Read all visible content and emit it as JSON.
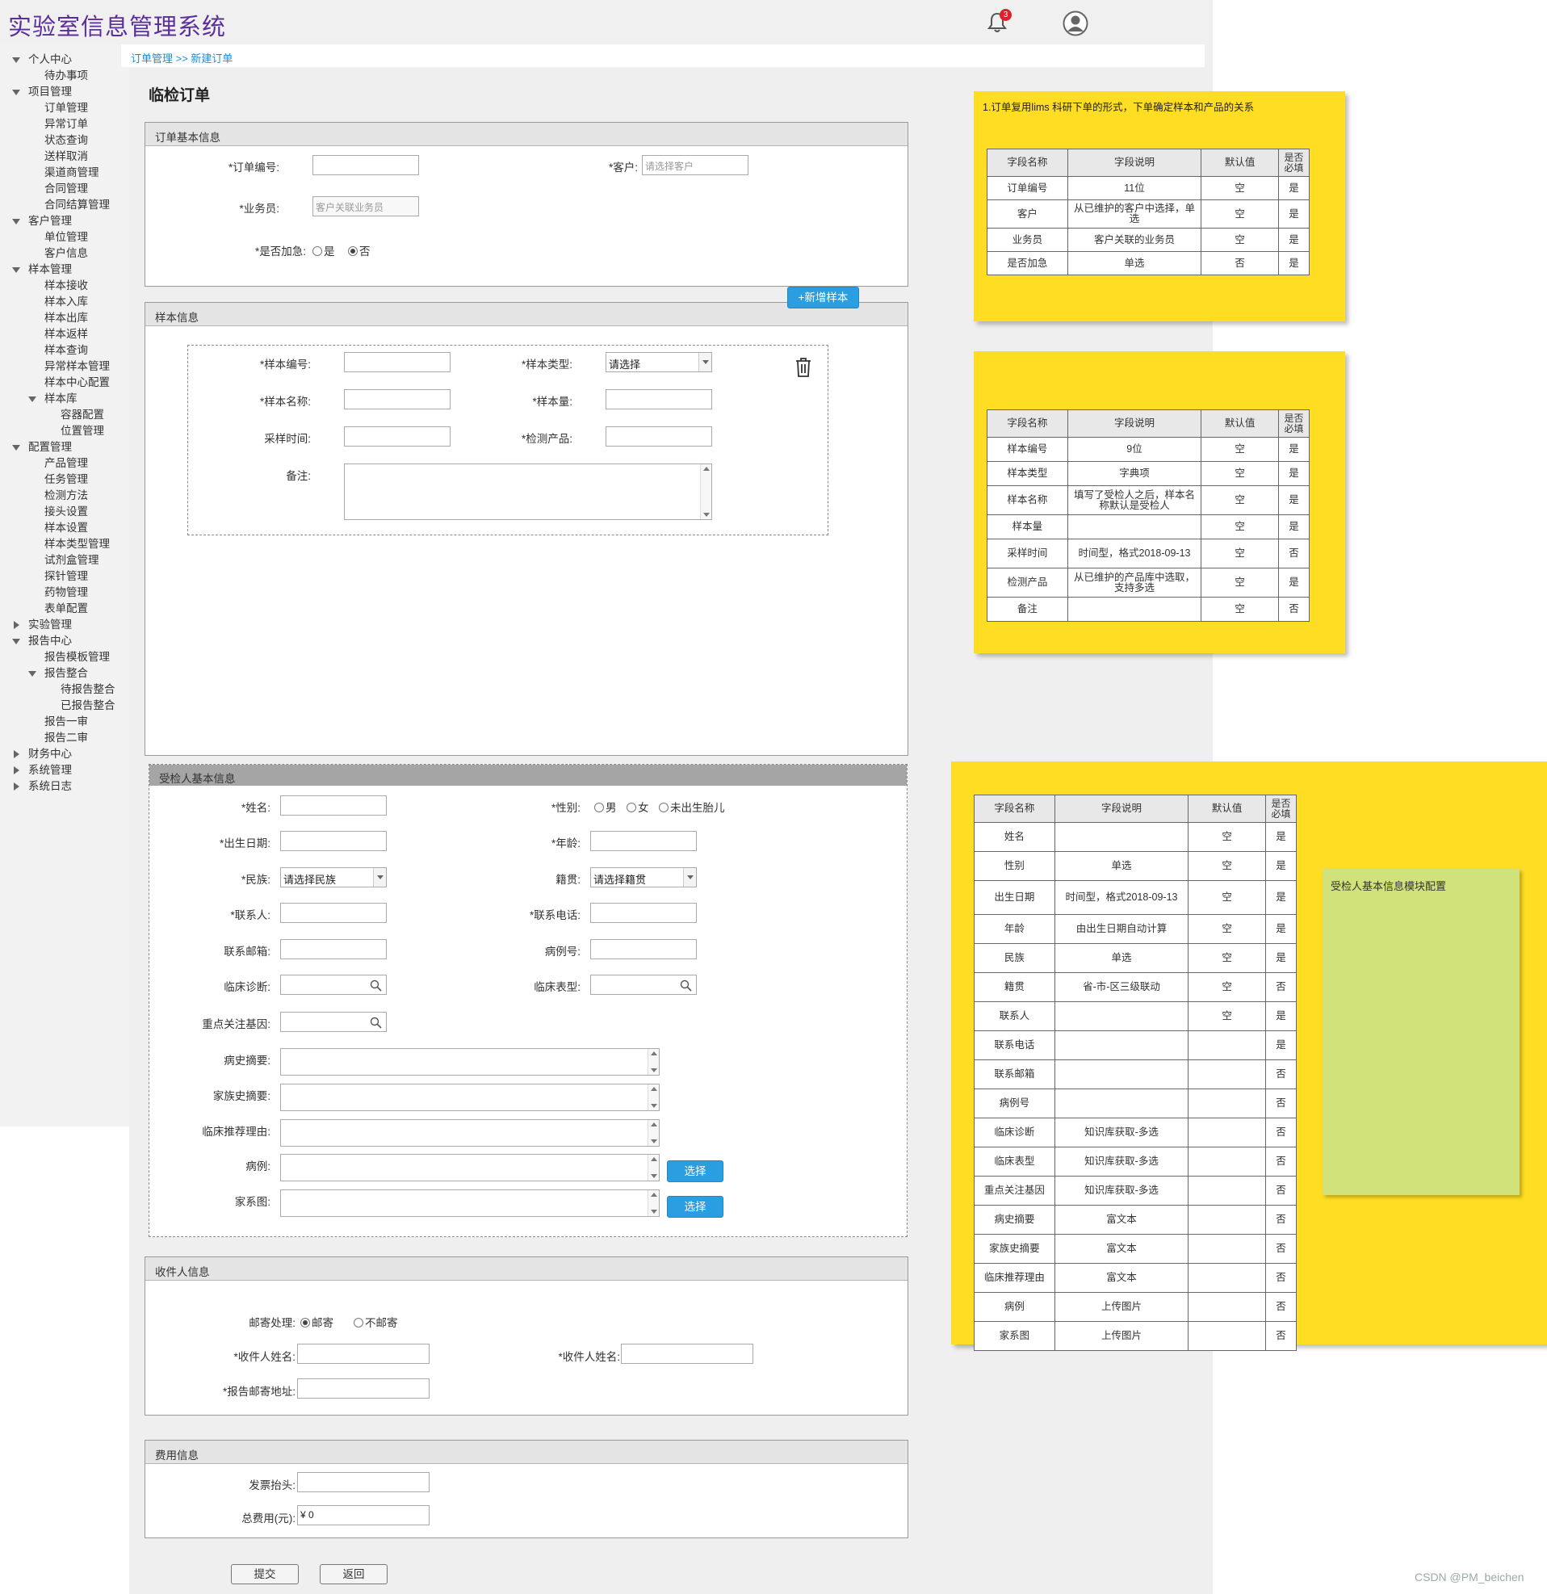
{
  "app": {
    "title": "实验室信息管理系统",
    "notification_count": "3"
  },
  "sidebar": {
    "items": [
      {
        "label": "个人中心",
        "level": 0,
        "state": "expanded"
      },
      {
        "label": "待办事项",
        "level": 1
      },
      {
        "label": "项目管理",
        "level": 0,
        "state": "expanded"
      },
      {
        "label": "订单管理",
        "level": 1
      },
      {
        "label": "异常订单",
        "level": 1
      },
      {
        "label": "状态查询",
        "level": 1
      },
      {
        "label": "送样取消",
        "level": 1
      },
      {
        "label": "渠道商管理",
        "level": 1
      },
      {
        "label": "合同管理",
        "level": 1
      },
      {
        "label": "合同结算管理",
        "level": 1
      },
      {
        "label": "客户管理",
        "level": 0,
        "state": "expanded"
      },
      {
        "label": "单位管理",
        "level": 1
      },
      {
        "label": "客户信息",
        "level": 1
      },
      {
        "label": "样本管理",
        "level": 0,
        "state": "expanded"
      },
      {
        "label": "样本接收",
        "level": 1
      },
      {
        "label": "样本入库",
        "level": 1
      },
      {
        "label": "样本出库",
        "level": 1
      },
      {
        "label": "样本返样",
        "level": 1
      },
      {
        "label": "样本查询",
        "level": 1
      },
      {
        "label": "异常样本管理",
        "level": 1
      },
      {
        "label": "样本中心配置",
        "level": 1
      },
      {
        "label": "样本库",
        "level": 1,
        "state": "expanded"
      },
      {
        "label": "容器配置",
        "level": 2
      },
      {
        "label": "位置管理",
        "level": 2
      },
      {
        "label": "配置管理",
        "level": 0,
        "state": "expanded"
      },
      {
        "label": "产品管理",
        "level": 1
      },
      {
        "label": "任务管理",
        "level": 1
      },
      {
        "label": "检测方法",
        "level": 1
      },
      {
        "label": "接头设置",
        "level": 1
      },
      {
        "label": "样本设置",
        "level": 1
      },
      {
        "label": "样本类型管理",
        "level": 1
      },
      {
        "label": "试剂盒管理",
        "level": 1
      },
      {
        "label": "探针管理",
        "level": 1
      },
      {
        "label": "药物管理",
        "level": 1
      },
      {
        "label": "表单配置",
        "level": 1
      },
      {
        "label": "实验管理",
        "level": 0,
        "state": "collapsed"
      },
      {
        "label": "报告中心",
        "level": 0,
        "state": "expanded"
      },
      {
        "label": "报告模板管理",
        "level": 1
      },
      {
        "label": "报告整合",
        "level": 1,
        "state": "expanded"
      },
      {
        "label": "待报告整合",
        "level": 2
      },
      {
        "label": "已报告整合",
        "level": 2
      },
      {
        "label": "报告一审",
        "level": 1
      },
      {
        "label": "报告二审",
        "level": 1
      },
      {
        "label": "财务中心",
        "level": 0,
        "state": "collapsed"
      },
      {
        "label": "系统管理",
        "level": 0,
        "state": "collapsed"
      },
      {
        "label": "系统日志",
        "level": 0,
        "state": "collapsed"
      }
    ]
  },
  "breadcrumb": "订单管理 >> 新建订单",
  "page_title": "临检订单",
  "order_basic": {
    "title": "订单基本信息",
    "order_no_label": "*订单编号:",
    "customer_label": "*客户:",
    "customer_placeholder": "请选择客户",
    "salesman_label": "*业务员:",
    "salesman_placeholder": "客户关联业务员",
    "urgent_label": "*是否加急:",
    "urgent_yes": "是",
    "urgent_no": "否",
    "urgent_selected": "否"
  },
  "add_sample_button": "+新增样本",
  "sample": {
    "title": "样本信息",
    "sample_no_label": "*样本编号:",
    "sample_type_label": "*样本类型:",
    "sample_type_value": "请选择",
    "sample_name_label": "*样本名称:",
    "sample_amount_label": "*样本量:",
    "sampling_time_label": "采样时间:",
    "test_product_label": "*检测产品:",
    "remark_label": "备注:"
  },
  "patient": {
    "title": "受检人基本信息",
    "name_label": "*姓名:",
    "gender_label": "*性别:",
    "gender_options": [
      "男",
      "女",
      "未出生胎儿"
    ],
    "birth_label": "*出生日期:",
    "age_label": "*年龄:",
    "ethnicity_label": "*民族:",
    "ethnicity_value": "请选择民族",
    "native_label": "籍贯:",
    "native_value": "请选择籍贯",
    "contact_label": "*联系人:",
    "phone_label": "*联系电话:",
    "email_label": "联系邮箱:",
    "case_no_label": "病例号:",
    "diagnosis_label": "临床诊断:",
    "phenotype_label": "临床表型:",
    "gene_label": "重点关注基因:",
    "history_label": "病史摘要:",
    "family_history_label": "家族史摘要:",
    "reason_label": "临床推荐理由:",
    "case_label": "病例:",
    "pedigree_label": "家系图:",
    "choose_label": "选择"
  },
  "recipient": {
    "title": "收件人信息",
    "mail_label": "邮寄处理:",
    "mail_options": [
      "邮寄",
      "不邮寄"
    ],
    "mail_selected": "邮寄",
    "name_label": "*收件人姓名:",
    "name_label_2": "*收件人姓名:",
    "address_label": "*报告邮寄地址:"
  },
  "fee": {
    "title": "费用信息",
    "invoice_label": "发票抬头:",
    "total_label": "总费用(元):",
    "total_value": "¥ 0"
  },
  "actions": {
    "submit": "提交",
    "back": "返回"
  },
  "notes": {
    "order_note": {
      "text": "1.订单复用lims 科研下单的形式，下单确定样本和产品的关系",
      "header": [
        "字段名称",
        "字段说明",
        "默认值",
        "是否必填"
      ],
      "rows": [
        [
          "订单编号",
          "11位",
          "空",
          "是"
        ],
        [
          "客户",
          "从已维护的客户中选择，单选",
          "空",
          "是"
        ],
        [
          "业务员",
          "客户关联的业务员",
          "空",
          "是"
        ],
        [
          "是否加急",
          "单选",
          "否",
          "是"
        ]
      ]
    },
    "sample_note": {
      "header": [
        "字段名称",
        "字段说明",
        "默认值",
        "是否必填"
      ],
      "rows": [
        [
          "样本编号",
          "9位",
          "空",
          "是"
        ],
        [
          "样本类型",
          "字典项",
          "空",
          "是"
        ],
        [
          "样本名称",
          "填写了受检人之后，样本名称默认是受检人",
          "空",
          "是"
        ],
        [
          "样本量",
          "",
          "空",
          "是"
        ],
        [
          "采样时间",
          "时间型，格式2018-09-13",
          "空",
          "否"
        ],
        [
          "检测产品",
          "从已维护的产品库中选取，支持多选",
          "空",
          "是"
        ],
        [
          "备注",
          "",
          "空",
          "否"
        ]
      ]
    },
    "patient_note": {
      "header": [
        "字段名称",
        "字段说明",
        "默认值",
        "是否必填"
      ],
      "rows": [
        [
          "姓名",
          "",
          "空",
          "是"
        ],
        [
          "性别",
          "单选",
          "空",
          "是"
        ],
        [
          "出生日期",
          "时间型，格式2018-09-13",
          "空",
          "是"
        ],
        [
          "年龄",
          "由出生日期自动计算",
          "空",
          "是"
        ],
        [
          "民族",
          "单选",
          "空",
          "是"
        ],
        [
          "籍贯",
          "省-市-区三级联动",
          "空",
          "否"
        ],
        [
          "联系人",
          "",
          "空",
          "是"
        ],
        [
          "联系电话",
          "",
          "",
          "是"
        ],
        [
          "联系邮箱",
          "",
          "",
          "否"
        ],
        [
          "病例号",
          "",
          "",
          "否"
        ],
        [
          "临床诊断",
          "知识库获取-多选",
          "",
          "否"
        ],
        [
          "临床表型",
          "知识库获取-多选",
          "",
          "否"
        ],
        [
          "重点关注基因",
          "知识库获取-多选",
          "",
          "否"
        ],
        [
          "病史摘要",
          "富文本",
          "",
          "否"
        ],
        [
          "家族史摘要",
          "富文本",
          "",
          "否"
        ],
        [
          "临床推荐理由",
          "富文本",
          "",
          "否"
        ],
        [
          "病例",
          "上传图片",
          "",
          "否"
        ],
        [
          "家系图",
          "上传图片",
          "",
          "否"
        ]
      ]
    },
    "green_note": "受检人基本信息模块配置"
  },
  "watermark": "CSDN @PM_beichen",
  "icons": {
    "notification": "bell-icon",
    "user": "user-avatar-icon",
    "delete": "trash-icon",
    "search": "search-icon",
    "expand": "triangle-down-icon",
    "collapse": "triangle-right-icon"
  },
  "colors": {
    "title": "#5b2e9a",
    "link": "#1a8fd4",
    "primary_button": "#2a9ee0",
    "note_yellow": "#ffdd22",
    "note_green": "#d1e27a",
    "badge": "#e0202a"
  }
}
